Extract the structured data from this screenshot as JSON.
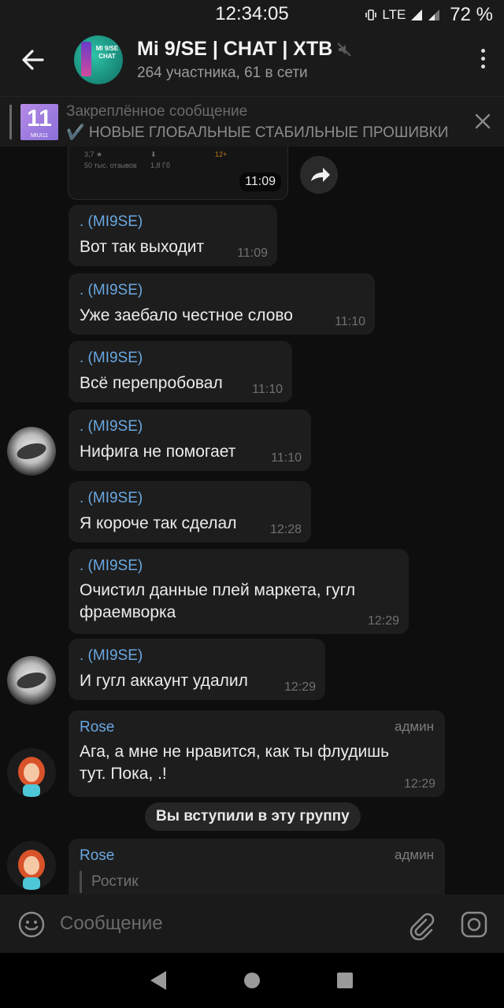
{
  "status_bar": {
    "time": "12:34:05",
    "network": "LTE",
    "battery": "72 %"
  },
  "header": {
    "avatar_text_line1": "MI 9/SE",
    "avatar_text_line2": "CHAT",
    "title": "Mi 9/SE | CHAT | XTB",
    "subtitle": "264 участника, 61 в сети"
  },
  "pinned": {
    "thumb_number": "11",
    "thumb_label": "MIUI11",
    "title": "Закреплённое сообщение",
    "text": "✔️ НОВЫЕ ГЛОБАЛЬНЫЕ СТАБИЛЬНЫЕ ПРОШИВКИ"
  },
  "media_message": {
    "info_rating": "3,7 ★",
    "info_reviews": "50 тыс. отзывов",
    "info_size": "1,8 Гб",
    "info_age": "12+",
    "time": "11:09"
  },
  "messages": [
    {
      "sender": ". (MI9SE)",
      "text": "Вот так выходит",
      "time": "11:09"
    },
    {
      "sender": ". (MI9SE)",
      "text": "Уже заебало честное слово",
      "time": "11:10"
    },
    {
      "sender": ". (MI9SE)",
      "text": "Всё перепробовал",
      "time": "11:10"
    },
    {
      "sender": ". (MI9SE)",
      "text": "Нифига не помогает",
      "time": "11:10"
    },
    {
      "sender": ". (MI9SE)",
      "text": "Я короче так сделал",
      "time": "12:28"
    },
    {
      "sender": ". (MI9SE)",
      "text_line1": "Очистил данные плей маркета, гугл",
      "text_line2": "фраемворка",
      "time": "12:29"
    },
    {
      "sender": ". (MI9SE)",
      "text": "И гугл аккаунт удалил",
      "time": "12:29"
    },
    {
      "sender": "Rose",
      "badge": "админ",
      "text_line1": "Ага, а мне не нравится, как ты флудишь",
      "text_line2": "тут. Пока, .!",
      "time": "12:29"
    },
    {
      "sender": "Rose",
      "badge": "админ",
      "quote": "Ростик"
    }
  ],
  "service_message": "Вы вступили в эту группу",
  "input": {
    "placeholder": "Сообщение"
  }
}
